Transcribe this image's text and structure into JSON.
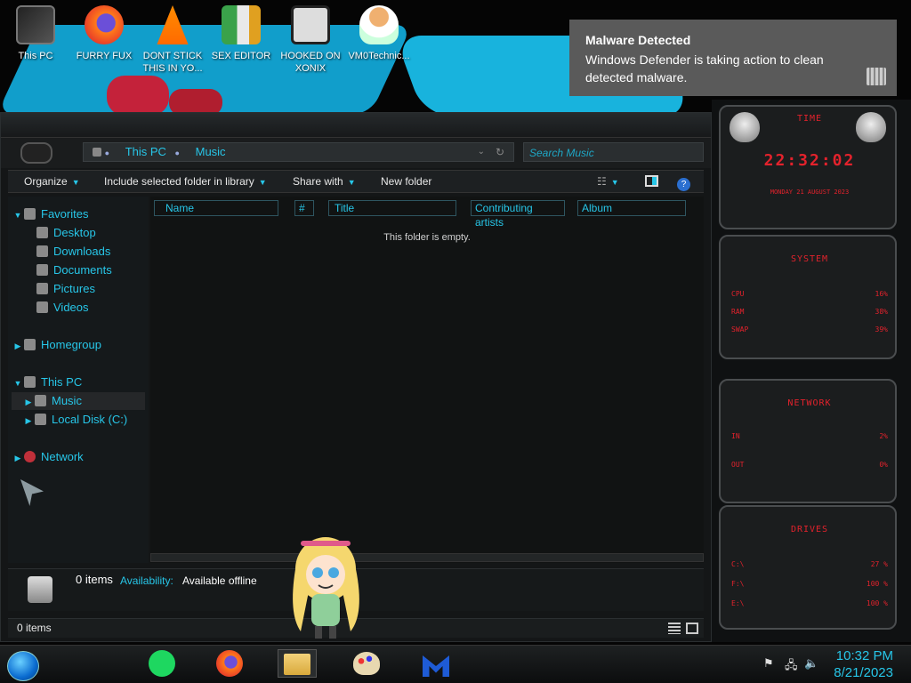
{
  "desktop": {
    "icons": [
      {
        "label": "This PC"
      },
      {
        "label": "FURRY FUX"
      },
      {
        "label": "DONT STICK THIS IN YO..."
      },
      {
        "label": "SEX EDITOR"
      },
      {
        "label": "HOOKED ON XONIX"
      },
      {
        "label": "VM0Technic..."
      }
    ]
  },
  "explorer": {
    "address": {
      "root": "This PC",
      "folder": "Music"
    },
    "search_placeholder": "Search Music",
    "toolbar": {
      "organize": "Organize",
      "include": "Include selected folder in library",
      "share": "Share with",
      "new_folder": "New folder"
    },
    "nav": {
      "favorites": "Favorites",
      "desktop": "Desktop",
      "downloads": "Downloads",
      "documents": "Documents",
      "pictures": "Pictures",
      "videos": "Videos",
      "homegroup": "Homegroup",
      "this_pc": "This PC",
      "music": "Music",
      "local_disk": "Local Disk (C:)",
      "network": "Network"
    },
    "columns": [
      "Name",
      "#",
      "Title",
      "Contributing artists",
      "Album"
    ],
    "empty_message": "This folder is empty.",
    "details": {
      "count": "0 items",
      "availability_label": "Availability:",
      "availability_value": "Available offline"
    },
    "status": "0 items"
  },
  "toast": {
    "title": "Malware Detected",
    "body": "Windows Defender is taking action to clean detected malware."
  },
  "gadgets": {
    "time": {
      "title": "TIME",
      "clock": "22:32:02",
      "date": "MONDAY 21 AUGUST 2023"
    },
    "system": {
      "title": "SYSTEM",
      "rows": [
        {
          "label": "CPU",
          "value": "16%"
        },
        {
          "label": "RAM",
          "value": "38%"
        },
        {
          "label": "SWAP",
          "value": "39%"
        }
      ]
    },
    "network": {
      "title": "NETWORK",
      "rows": [
        {
          "label": "IN",
          "value": "2%"
        },
        {
          "label": "OUT",
          "value": "0%"
        }
      ]
    },
    "drives": {
      "title": "DRIVES",
      "rows": [
        {
          "label": "C:\\",
          "value": "27 %"
        },
        {
          "label": "F:\\",
          "value": "100 %"
        },
        {
          "label": "E:\\",
          "value": "100 %"
        }
      ]
    }
  },
  "taskbar": {
    "time": "10:32 PM",
    "date": "8/21/2023"
  },
  "colors": {
    "accent": "#27c6e8",
    "gadget_red": "#e3222c",
    "toast_bg": "#5a5a5a"
  }
}
